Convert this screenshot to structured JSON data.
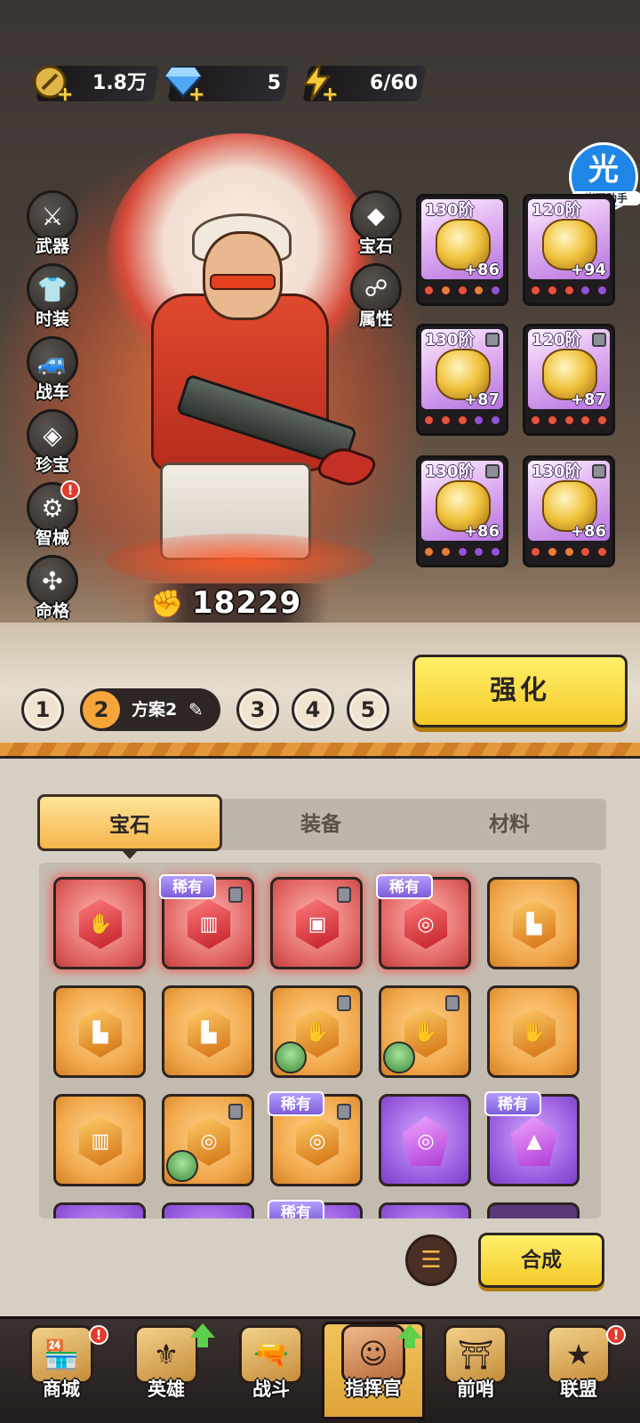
{
  "resources": {
    "gold": {
      "icon": "gold-coin-icon",
      "value": "1.8万"
    },
    "diamond": {
      "icon": "diamond-icon",
      "value": "5"
    },
    "energy": {
      "icon": "lightning-icon",
      "value": "6/60"
    }
  },
  "left_menu": [
    {
      "label": "武器",
      "icon": "weapon-icon"
    },
    {
      "label": "时装",
      "icon": "costume-icon"
    },
    {
      "label": "战车",
      "icon": "vehicle-icon"
    },
    {
      "label": "珍宝",
      "icon": "treasure-icon"
    },
    {
      "label": "智械",
      "icon": "mech-icon",
      "alert": "!"
    },
    {
      "label": "命格",
      "icon": "destiny-icon"
    }
  ],
  "right_menu": [
    {
      "label": "宝石",
      "icon": "gem-icon"
    },
    {
      "label": "属性",
      "icon": "attribute-icon"
    }
  ],
  "assistant": {
    "logo": "光",
    "label": "光环助手"
  },
  "power": {
    "value": "18229"
  },
  "equipment": [
    {
      "tier": "130阶",
      "bonus": "+86",
      "locked": false
    },
    {
      "tier": "120阶",
      "bonus": "+94",
      "locked": false
    },
    {
      "tier": "130阶",
      "bonus": "+87",
      "locked": true
    },
    {
      "tier": "120阶",
      "bonus": "+87",
      "locked": true
    },
    {
      "tier": "130阶",
      "bonus": "+86",
      "locked": true
    },
    {
      "tier": "130阶",
      "bonus": "+86",
      "locked": true
    }
  ],
  "plans": {
    "numbers": [
      "1",
      "3",
      "4",
      "5"
    ],
    "active_number": "2",
    "active_name": "方案2",
    "edit_icon": "pencil-icon"
  },
  "strengthen_label": "强化",
  "tabs": [
    "宝石",
    "装备",
    "材料"
  ],
  "rare_label": "稀有",
  "filter_icon": "filter-icon",
  "merge_label": "合成",
  "nav": [
    {
      "label": "商城",
      "icon": "shop-icon",
      "alert": "!"
    },
    {
      "label": "英雄",
      "icon": "hero-icon",
      "upgrade": true
    },
    {
      "label": "战斗",
      "icon": "battle-icon"
    },
    {
      "label": "指挥官",
      "icon": "commander-icon",
      "upgrade": true,
      "active": true
    },
    {
      "label": "前哨",
      "icon": "outpost-icon"
    },
    {
      "label": "联盟",
      "icon": "alliance-icon",
      "alert": "!"
    }
  ]
}
